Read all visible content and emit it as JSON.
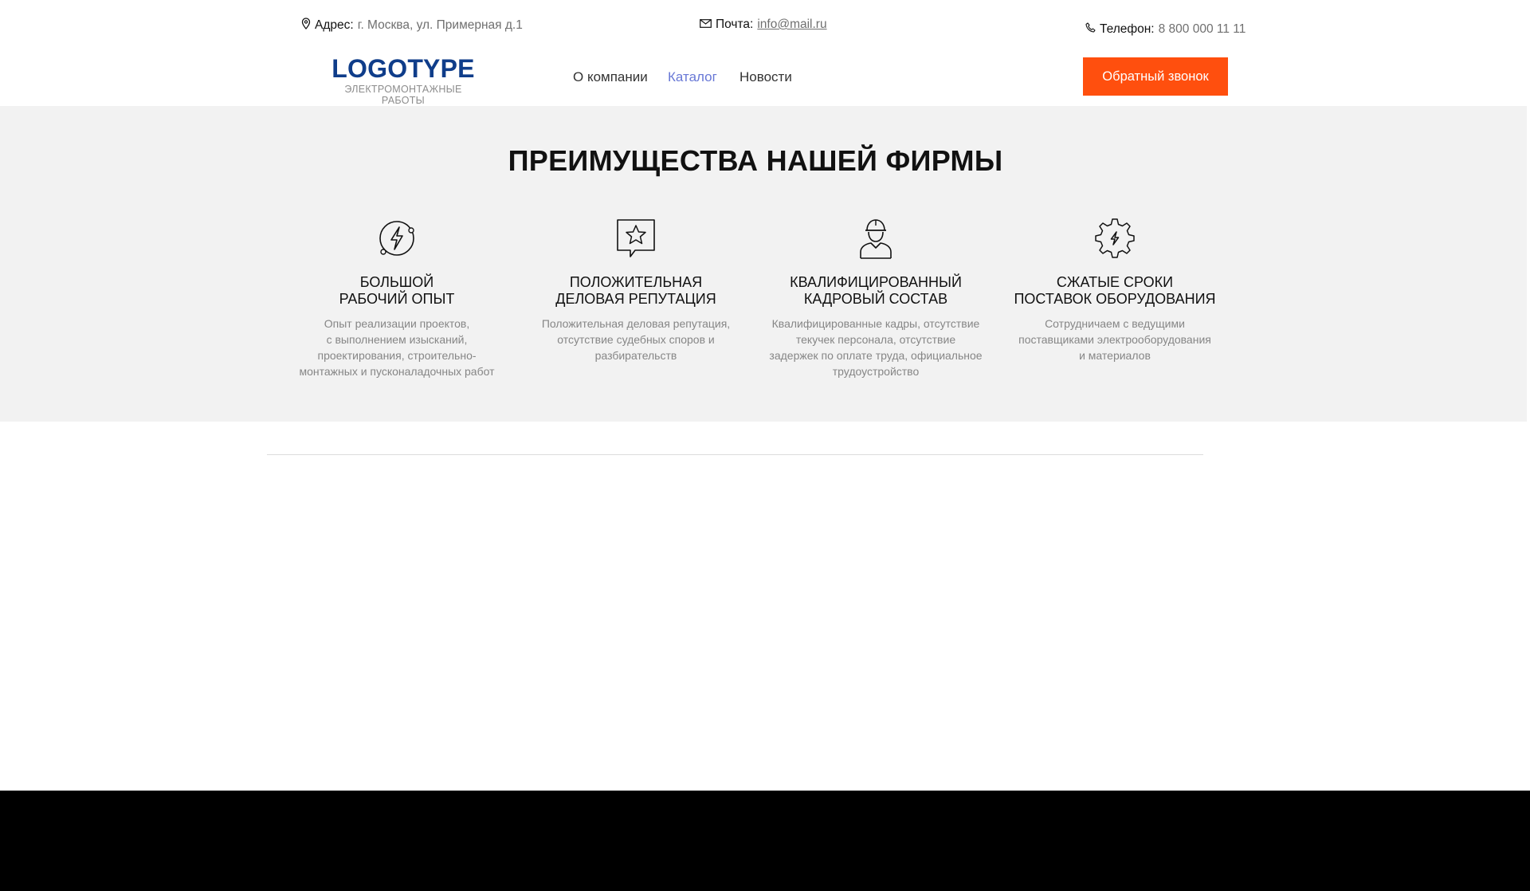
{
  "topbar": {
    "address": {
      "label": "Адрес:",
      "value": "г. Москва, ул. Примерная д.1",
      "icon": "location-pin-icon"
    },
    "email": {
      "label": "Почта:",
      "value": "info@mail.ru",
      "icon": "envelope-icon"
    },
    "phone": {
      "label": "Телефон:",
      "value": "8 800 000 11 11",
      "icon": "phone-icon"
    }
  },
  "logo": {
    "title": "LOGOTYPE",
    "subtitle": "ЭЛЕКТРОМОНТАЖНЫЕ РАБОТЫ"
  },
  "nav": {
    "items": [
      {
        "label": "О компании",
        "active": false
      },
      {
        "label": "Каталог",
        "active": true
      },
      {
        "label": "Новости",
        "active": false
      }
    ],
    "callback_label": "Обратный звонок"
  },
  "advantages": {
    "title": "ПРЕИМУЩЕСТВА НАШЕЙ ФИРМЫ",
    "items": [
      {
        "icon": "lightning-plug-icon",
        "heading": "БОЛЬШОЙ\nРАБОЧИЙ ОПЫТ",
        "text": "Опыт реализации проектов,\nс выполнением изысканий,\nпроектирования, строительно-\nмонтажных и пусконаладочных работ"
      },
      {
        "icon": "star-chat-icon",
        "heading": "ПОЛОЖИТЕЛЬНАЯ\nДЕЛОВАЯ РЕПУТАЦИЯ",
        "text": "Положительная деловая репутация,\nотсутствие судебных споров и\nразбирательств"
      },
      {
        "icon": "worker-helmet-icon",
        "heading": "КВАЛИФИЦИРОВАННЫЙ\nКАДРОВЫЙ СОСТАВ",
        "text": "Квалифицированные кадры, отсутствие\nтекучек персонала, отсутствие\nзадержек по оплате труда, официальное\nтрудоустройство"
      },
      {
        "icon": "gear-lightning-icon",
        "heading": "СЖАТЫЕ СРОКИ\nПОСТАВОК ОБОРУДОВАНИЯ",
        "text": "Сотрудничаем с ведущими\nпоставщиками электрооборудования\nи материалов"
      }
    ]
  },
  "colors": {
    "accent": "#ff4f0e",
    "logo": "#0f3d8a",
    "nav_active": "#6878d6",
    "section_bg": "#f2f2f2"
  }
}
